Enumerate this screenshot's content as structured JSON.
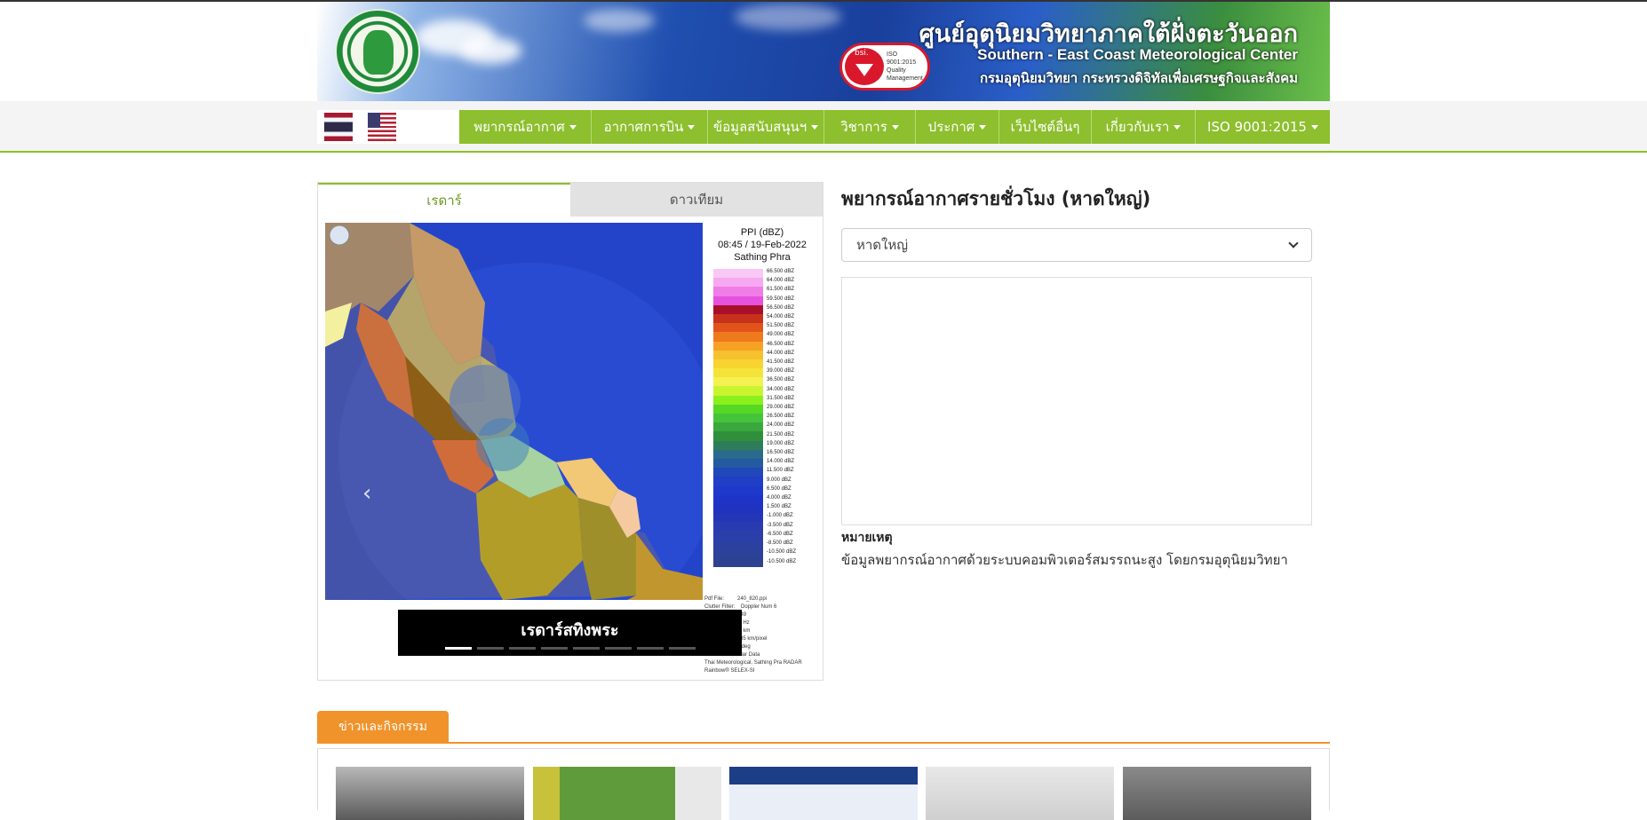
{
  "header": {
    "title_th": "ศูนย์อุตุนิยมวิทยาภาคใต้ฝั่งตะวันออก",
    "title_en": "Southern - East Coast Meteorological Center",
    "subtitle_th": "กรมอุตุนิยมวิทยา กระทรวงดิจิทัลเพื่อเศรษฐกิจและสังคม",
    "iso_badge": {
      "brand": "bsi.",
      "text": "ISO 9001:2015 Quality Management"
    }
  },
  "languages": [
    {
      "name": "thai-flag-icon"
    },
    {
      "name": "us-flag-icon"
    }
  ],
  "nav": {
    "items": [
      {
        "label": "พยากรณ์อากาศ",
        "dropdown": true
      },
      {
        "label": "อากาศการบิน",
        "dropdown": true
      },
      {
        "label": "ข้อมูลสนับสนุนฯ",
        "dropdown": true
      },
      {
        "label": "วิชาการ",
        "dropdown": true
      },
      {
        "label": "ประกาศ",
        "dropdown": true
      },
      {
        "label": "เว็บไซต์อื่นๆ",
        "dropdown": false
      },
      {
        "label": "เกี่ยวกับเรา",
        "dropdown": true
      },
      {
        "label": "ISO 9001:2015",
        "dropdown": true
      }
    ],
    "accent": "#8dbf2e"
  },
  "radar": {
    "tabs": [
      {
        "label": "เรดาร์",
        "active": true
      },
      {
        "label": "ดาวเทียม",
        "active": false
      }
    ],
    "legend": {
      "line1": "PPI (dBZ)",
      "line2": "08:45 / 19-Feb-2022",
      "line3": "Sathing Phra",
      "levels": [
        "66.500 dBZ",
        "64.000 dBZ",
        "61.500 dBZ",
        "59.500 dBZ",
        "56.500 dBZ",
        "54.000 dBZ",
        "51.500 dBZ",
        "49.000 dBZ",
        "46.500 dBZ",
        "44.000 dBZ",
        "41.500 dBZ",
        "39.000 dBZ",
        "36.500 dBZ",
        "34.000 dBZ",
        "31.500 dBZ",
        "29.000 dBZ",
        "26.500 dBZ",
        "24.000 dBZ",
        "21.500 dBZ",
        "19.000 dBZ",
        "16.500 dBZ",
        "14.000 dBZ",
        "11.500 dBZ",
        "9.000 dBZ",
        "6.500 dBZ",
        "4.000 dBZ",
        "1.500 dBZ",
        "-1.000 dBZ",
        "-3.500 dBZ",
        "-6.500 dBZ",
        "-8.500 dBZ",
        "-10.500 dBZ",
        "-10.500 dBZ"
      ],
      "colors": [
        "#f9c8f5",
        "#f7a9f0",
        "#f07ce8",
        "#e651de",
        "#a8102a",
        "#c8321c",
        "#e0541c",
        "#ef7a1e",
        "#f7a125",
        "#f6c12e",
        "#f7d430",
        "#f5e33a",
        "#f3f250",
        "#c8f530",
        "#8cf01c",
        "#56d824",
        "#44c43a",
        "#3aa83e",
        "#2f8f3a",
        "#2e7d5a",
        "#2a6a8a",
        "#235aa0",
        "#2048b8",
        "#1e3fc6",
        "#1f38cc",
        "#1e34c8",
        "#2032c0",
        "#2436b8",
        "#2a3bb2",
        "#2b3faa",
        "#2c40a2",
        "#2c4198",
        "#2c4190"
      ],
      "meta": "Pdf File:         240_820.ppi\nClutter Filter:    Doppler Num 6\nTime sampling:49\n                   625 Hz\n                   240 km\n                   0.585 km/pixel\n                   0.5 deg\n                   Radar Data\nThai Meteorological, Sathing Pra RADAR\nRainbow® SELEX-SI"
    },
    "caption": "เรดาร์สทิงพระ",
    "slide_count": 8,
    "active_slide": 0
  },
  "forecast": {
    "title": "พยากรณ์อากาศรายชั่วโมง (หาดใหญ่)",
    "selected": "หาดใหญ่",
    "note_heading": "หมายเหตุ",
    "note_text": "ข้อมูลพยากรณ์อากาศด้วยระบบคอมพิวเตอร์สมรรถนะสูง โดยกรมอุตุนิยมวิทยา"
  },
  "news": {
    "tab_label": "ข่าวและกิจกรรม",
    "accent": "#f0932b"
  }
}
